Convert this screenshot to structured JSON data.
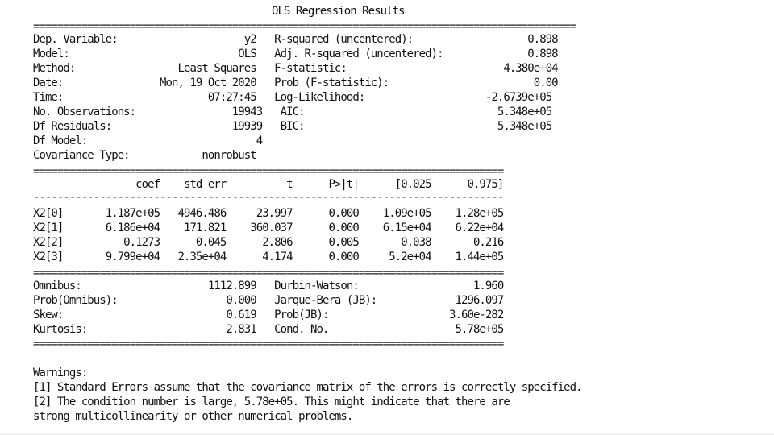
{
  "title": "OLS Regression Results",
  "header_lines": [
    "Dep. Variable:                     y2   R-squared (uncentered):                   0.898",
    "Model:                            OLS   Adj. R-squared (uncentered):              0.898",
    "Method:                 Least Squares   F-statistic:                          4.380e+04",
    "Date:                Mon, 19 Oct 2020   Prob (F-statistic):                        0.00",
    "Time:                        07:27:45   Log-Likelihood:                    -2.6739e+05",
    "No. Observations:                19943   AIC:                                5.348e+05",
    "Df Residuals:                    19939   BIC:                                5.348e+05",
    "Df Model:                            4",
    "Covariance Type:            nonrobust"
  ],
  "coef_table": {
    "header": "                 coef    std err          t      P>|t|      [0.025      0.975]",
    "rows": [
      "X2[0]       1.187e+05   4946.486     23.997      0.000    1.09e+05    1.28e+05",
      "X2[1]       6.186e+04    171.821    360.037      0.000    6.15e+04    6.22e+04",
      "X2[2]          0.1273      0.045      2.806      0.005       0.038       0.216",
      "X2[3]       9.799e+04   2.35e+04      4.174      0.000     5.2e+04    1.44e+05"
    ]
  },
  "diagnostics_lines": [
    "Omnibus:                     1112.899   Durbin-Watson:                   1.960",
    "Prob(Omnibus):                  0.000   Jarque-Bera (JB):             1296.097",
    "Skew:                           0.619   Prob(JB):                    3.60e-282",
    "Kurtosis:                       2.831   Cond. No.                     5.78e+05"
  ],
  "warnings": {
    "heading": "Warnings:",
    "lines": [
      "[1] Standard Errors assume that the covariance matrix of the errors is correctly specified.",
      "[2] The condition number is large, 5.78e+05. This might indicate that there are",
      "strong multicollinearity or other numerical problems."
    ]
  },
  "separators": {
    "wide_eq": "==========================================================================================",
    "narrow_eq": "==============================================================================",
    "narrow_dash": "------------------------------------------------------------------------------"
  }
}
